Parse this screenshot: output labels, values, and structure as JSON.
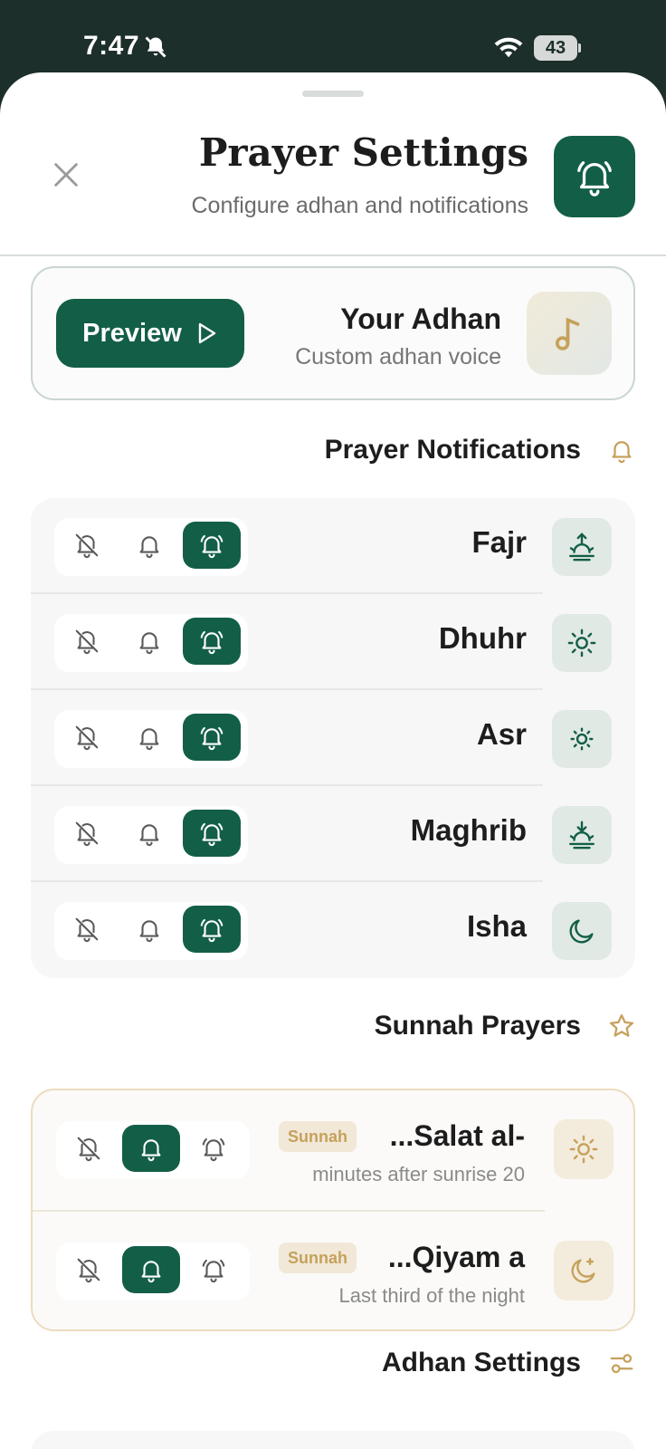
{
  "status_bar": {
    "time": "7:47",
    "battery": "43"
  },
  "header": {
    "title": "Prayer Settings",
    "subtitle": "Configure adhan and notifications"
  },
  "adhan_card": {
    "preview_label": "Preview",
    "title": "Your Adhan",
    "subtitle": "Custom adhan voice"
  },
  "sections": {
    "prayer_notifications": "Prayer Notifications",
    "sunnah_prayers": "Sunnah Prayers",
    "adhan_settings": "Adhan Settings"
  },
  "prayers": [
    {
      "name": "Fajr",
      "icon": "sunrise-icon",
      "mode": "adhan"
    },
    {
      "name": "Dhuhr",
      "icon": "sun-icon",
      "mode": "adhan"
    },
    {
      "name": "Asr",
      "icon": "small-sun-icon",
      "mode": "adhan"
    },
    {
      "name": "Maghrib",
      "icon": "sunset-icon",
      "mode": "adhan"
    },
    {
      "name": "Isha",
      "icon": "moon-icon",
      "mode": "adhan"
    }
  ],
  "sunnah": [
    {
      "badge": "Sunnah",
      "name": "...Salat al-",
      "subtitle": "minutes after sunrise 20",
      "icon": "sun-icon",
      "mode": "notify"
    },
    {
      "badge": "Sunnah",
      "name": "...Qiyam a",
      "subtitle": "Last third of the night",
      "icon": "moon-star-icon",
      "mode": "notify"
    }
  ],
  "colors": {
    "primary": "#135e47",
    "gold": "#c6a15b",
    "status_bg": "#1c2f2a"
  }
}
